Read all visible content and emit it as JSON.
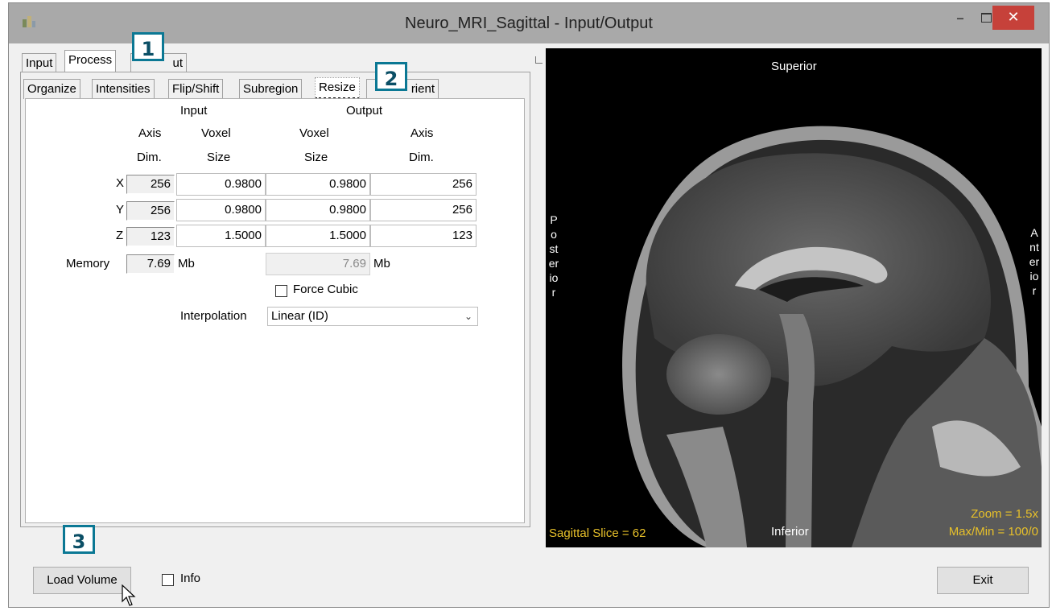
{
  "window": {
    "title": "Neuro_MRI_Sagittal - Input/Output",
    "close_glyph": "✕",
    "min_glyph": "–"
  },
  "tabs": [
    "Input",
    "Process",
    "Output"
  ],
  "tab_output_visible": "ut",
  "subtabs": [
    "Organize",
    "Intensities",
    "Flip/Shift",
    "Subregion",
    "Resize",
    "Orient"
  ],
  "subtab_orient_visible": "rient",
  "resize": {
    "header_input": "Input",
    "header_output": "Output",
    "col_axis_1": "Axis",
    "col_axis_2": "Dim.",
    "col_voxel_1": "Voxel",
    "col_voxel_2": "Size",
    "col_ovoxel_1": "Voxel",
    "col_ovoxel_2": "Size",
    "col_oaxis_1": "Axis",
    "col_oaxis_2": "Dim.",
    "rows": [
      {
        "axis": "X",
        "in_dim": "256",
        "in_voxel": "0.9800",
        "out_voxel": "0.9800",
        "out_dim": "256"
      },
      {
        "axis": "Y",
        "in_dim": "256",
        "in_voxel": "0.9800",
        "out_voxel": "0.9800",
        "out_dim": "256"
      },
      {
        "axis": "Z",
        "in_dim": "123",
        "in_voxel": "1.5000",
        "out_voxel": "1.5000",
        "out_dim": "123"
      }
    ],
    "memory_label": "Memory",
    "memory_in": "7.69",
    "memory_out": "7.69",
    "unit": "Mb",
    "force_cubic_label": "Force Cubic",
    "force_cubic_checked": false,
    "interpolation_label": "Interpolation",
    "interpolation_value": "Linear (ID)"
  },
  "callouts": [
    "1",
    "2",
    "3"
  ],
  "viewer": {
    "superior": "Superior",
    "inferior": "Inferior",
    "posterior": "Posterior",
    "anterior": "Anterior",
    "slice": "Sagittal Slice = 62",
    "zoom": "Zoom = 1.5x",
    "maxmin": "Max/Min = 100/0",
    "overlay_color": "#e7c02a"
  },
  "footer": {
    "load_volume": "Load Volume",
    "info_label": "Info",
    "info_checked": false,
    "exit": "Exit"
  },
  "colors": {
    "close_button": "#c6413a",
    "callout_border": "#0b7894",
    "titlebar": "#a9a9a9"
  }
}
